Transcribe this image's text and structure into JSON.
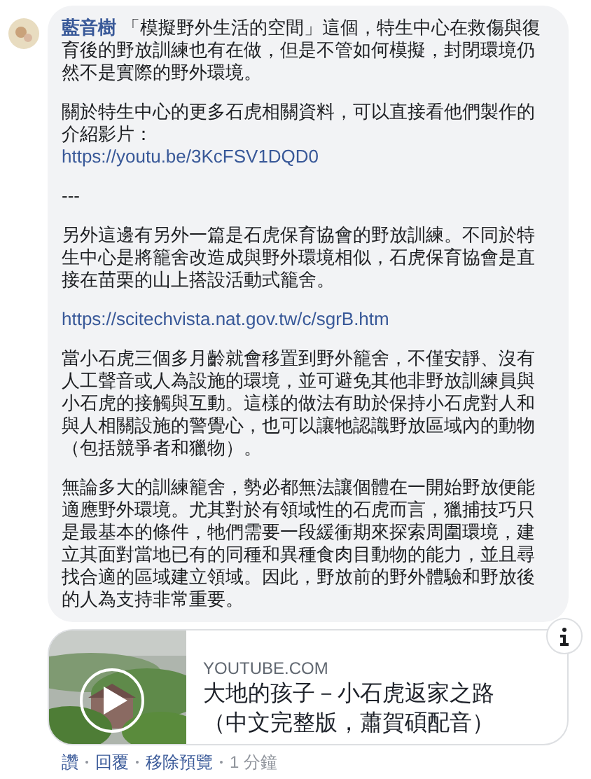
{
  "comment": {
    "author": "藍音樹",
    "paragraphs": [
      {
        "lines": [
          {
            "kind": "text",
            "text": "「模擬野外生活的空間」這個，特生中心在救傷與復育後的野放訓練也有在做，但是不管如何模擬，封閉環境仍然不是實際的野外環境。"
          }
        ]
      },
      {
        "lines": [
          {
            "kind": "text",
            "text": "關於特生中心的更多石虎相關資料，可以直接看他們製作的介紹影片："
          },
          {
            "kind": "link",
            "text": "https://youtu.be/3KcFSV1DQD0"
          }
        ]
      },
      {
        "lines": [
          {
            "kind": "text",
            "text": "---"
          }
        ]
      },
      {
        "lines": [
          {
            "kind": "text",
            "text": "另外這邊有另外一篇是石虎保育協會的野放訓練。不同於特生中心是將籠舍改造成與野外環境相似，石虎保育協會是直接在苗栗的山上搭設活動式籠舍。"
          }
        ]
      },
      {
        "lines": [
          {
            "kind": "link",
            "text": "https://scitechvista.nat.gov.tw/c/sgrB.htm"
          }
        ]
      },
      {
        "lines": [
          {
            "kind": "text",
            "text": "當小石虎三個多月齡就會移置到野外籠舍，不僅安靜、沒有人工聲音或人為設施的環境，並可避免其他非野放訓練員與小石虎的接觸與互動。這樣的做法有助於保持小石虎對人和與人相關設施的警覺心，也可以讓牠認識野放區域內的動物（包括競爭者和獵物）。"
          }
        ]
      },
      {
        "lines": [
          {
            "kind": "text",
            "text": "無論多大的訓練籠舍，勢必都無法讓個體在一開始野放便能適應野外環境。尤其對於有領域性的石虎而言，獵捕技巧只是最基本的條件，牠們需要一段緩衝期來探索周圍環境，建立其面對當地已有的同種和異種食肉目動物的能力，並且尋找合適的區域建立領域。因此，野放前的野外體驗和野放後的人為支持非常重要。"
          }
        ]
      }
    ]
  },
  "preview": {
    "kind": "picture",
    "site": "YOUTUBE.COM",
    "title": "大地的孩子－小石虎返家之路（中文完整版，蕭賀碩配音）"
  },
  "actions": [
    {
      "kind": "link",
      "text": "讚"
    },
    {
      "kind": "link",
      "text": "回覆"
    },
    {
      "kind": "link",
      "text": "移除預覽"
    },
    {
      "kind": "time",
      "text": "1 分鐘"
    }
  ]
}
